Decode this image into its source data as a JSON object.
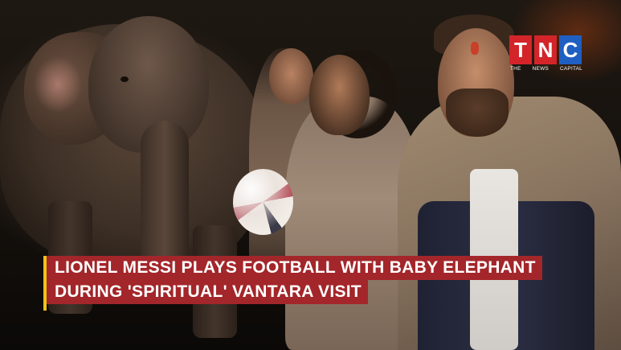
{
  "logo": {
    "letters": [
      "T",
      "N",
      "C"
    ],
    "subtitle": [
      "THE",
      "NEWS",
      "CAPITAL"
    ],
    "colors": {
      "red": "#d3242a",
      "blue": "#1f5fc1"
    }
  },
  "headline": {
    "lines": [
      "LIONEL MESSI PLAYS FOOTBALL WITH BABY ELEPHANT",
      "DURING 'SPIRITUAL' VANTARA VISIT"
    ],
    "background_color": "#a3262a",
    "accent_color": "#f0c21b"
  }
}
